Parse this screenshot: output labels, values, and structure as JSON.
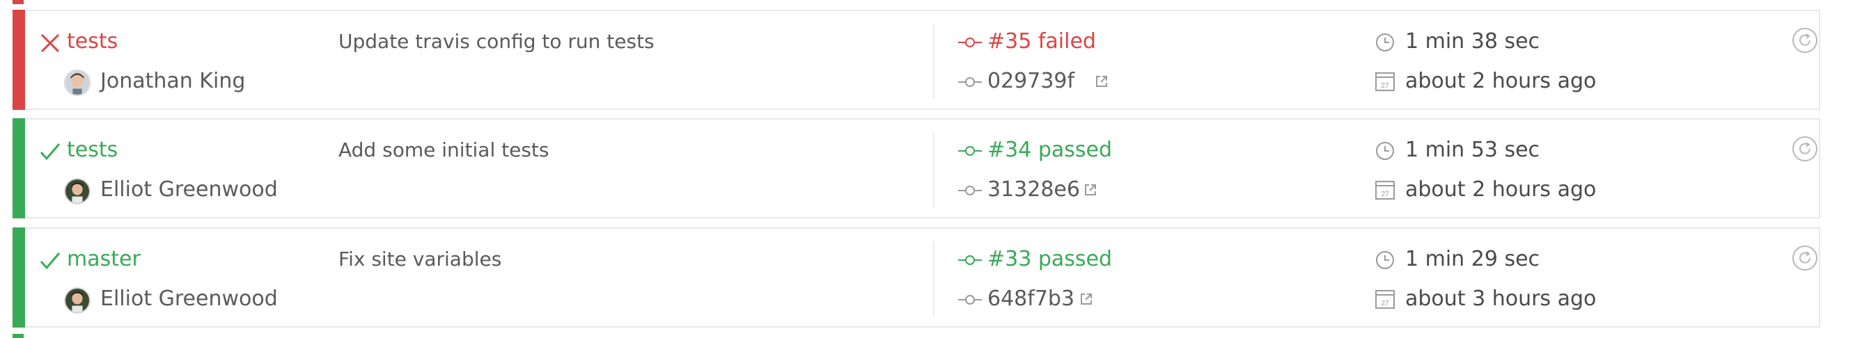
{
  "colors": {
    "failed": "#db4545",
    "passed": "#39aa56",
    "text": "#5a5a5a",
    "muted": "#9a9a9a",
    "border": "#e8e8e8"
  },
  "builds": [
    {
      "state": "failed",
      "status_icon": "cross-icon",
      "branch": "tests",
      "author": "Jonathan King",
      "message": "Update travis config to run tests",
      "build_label": "#35 failed",
      "commit": "029739f",
      "duration": "1 min 38 sec",
      "finished": "about 2 hours ago"
    },
    {
      "state": "passed",
      "status_icon": "check-icon",
      "branch": "tests",
      "author": "Elliot Greenwood",
      "message": "Add some initial tests",
      "build_label": "#34 passed",
      "commit": "31328e6",
      "duration": "1 min 53 sec",
      "finished": "about 2 hours ago"
    },
    {
      "state": "passed",
      "status_icon": "check-icon",
      "branch": "master",
      "author": "Elliot Greenwood",
      "message": "Fix site variables",
      "build_label": "#33 passed",
      "commit": "648f7b3",
      "duration": "1 min 29 sec",
      "finished": "about 3 hours ago"
    }
  ],
  "calendar_icon_day": "27"
}
